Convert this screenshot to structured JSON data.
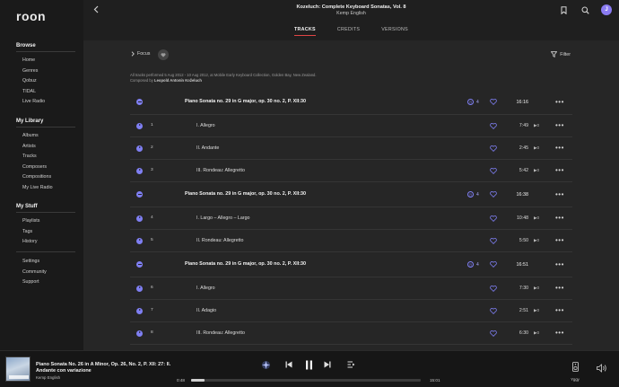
{
  "app": {
    "logo": "roon"
  },
  "sidebar": {
    "browse": {
      "heading": "Browse",
      "items": [
        "Home",
        "Genres",
        "Qobuz",
        "TIDAL",
        "Live Radio"
      ]
    },
    "library": {
      "heading": "My Library",
      "items": [
        "Albums",
        "Artists",
        "Tracks",
        "Composers",
        "Compositions",
        "My Live Radio"
      ]
    },
    "stuff": {
      "heading": "My Stuff",
      "items": [
        "Playlists",
        "Tags",
        "History"
      ]
    },
    "bottom": {
      "items": [
        "Settings",
        "Community",
        "Support"
      ]
    }
  },
  "header": {
    "album_title": "Kozeluch: Complete Keyboard Sonatas, Vol. 8",
    "album_artist": "Kemp English",
    "avatar_initial": "J",
    "tabs": [
      "TRACKS",
      "CREDITS",
      "VERSIONS"
    ],
    "active_tab": "TRACKS"
  },
  "toolbar": {
    "focus_label": "Focus",
    "filter_label": "Filter"
  },
  "info": {
    "recording": "All tracks performed 5 Aug 2012 - 10 Aug 2012, at Mobile Early Keyboard Collection, Golden Bay, New Zealand.",
    "composed_prefix": "Composed by",
    "composer": "Leopold Antonín Koželuch"
  },
  "works": [
    {
      "title": "Piano Sonata no. 29 in G major, op. 30 no. 2, P. XII:30",
      "count": "4",
      "duration": "16:16",
      "tracks": [
        {
          "no": "1",
          "title": "I. Allegro",
          "duration": "7:49",
          "plays": "0"
        },
        {
          "no": "2",
          "title": "II. Andante",
          "duration": "2:45",
          "plays": "0"
        },
        {
          "no": "3",
          "title": "III. Rondeau: Allegretto",
          "duration": "5:42",
          "plays": "0"
        }
      ]
    },
    {
      "title": "Piano Sonata no. 29 in G major, op. 30 no. 2, P. XII:30",
      "count": "4",
      "duration": "16:38",
      "tracks": [
        {
          "no": "4",
          "title": "I. Largo – Allegro – Largo",
          "duration": "10:48",
          "plays": "0"
        },
        {
          "no": "5",
          "title": "II. Rondeau: Allegretto",
          "duration": "5:50",
          "plays": "0"
        }
      ]
    },
    {
      "title": "Piano Sonata no. 29 in G major, op. 30 no. 2, P. XII:30",
      "count": "4",
      "duration": "16:51",
      "tracks": [
        {
          "no": "6",
          "title": "I. Allegro",
          "duration": "7:30",
          "plays": "0"
        },
        {
          "no": "7",
          "title": "II. Adagio",
          "duration": "2:51",
          "plays": "0"
        },
        {
          "no": "8",
          "title": "III. Rondeau: Allegretto",
          "duration": "6:30",
          "plays": "0"
        }
      ]
    }
  ],
  "player": {
    "title": "Piano Sonata No. 26 in A Minor, Op. 26, No. 2, P. XII: 27: II. Andante con variazione",
    "artist": "Kemp English",
    "elapsed": "0:48",
    "total": "15:01",
    "progress": 0.06,
    "zone": "Yggy"
  },
  "colors": {
    "accent": "#7f7ff3",
    "tab_underline": "#e04545"
  }
}
